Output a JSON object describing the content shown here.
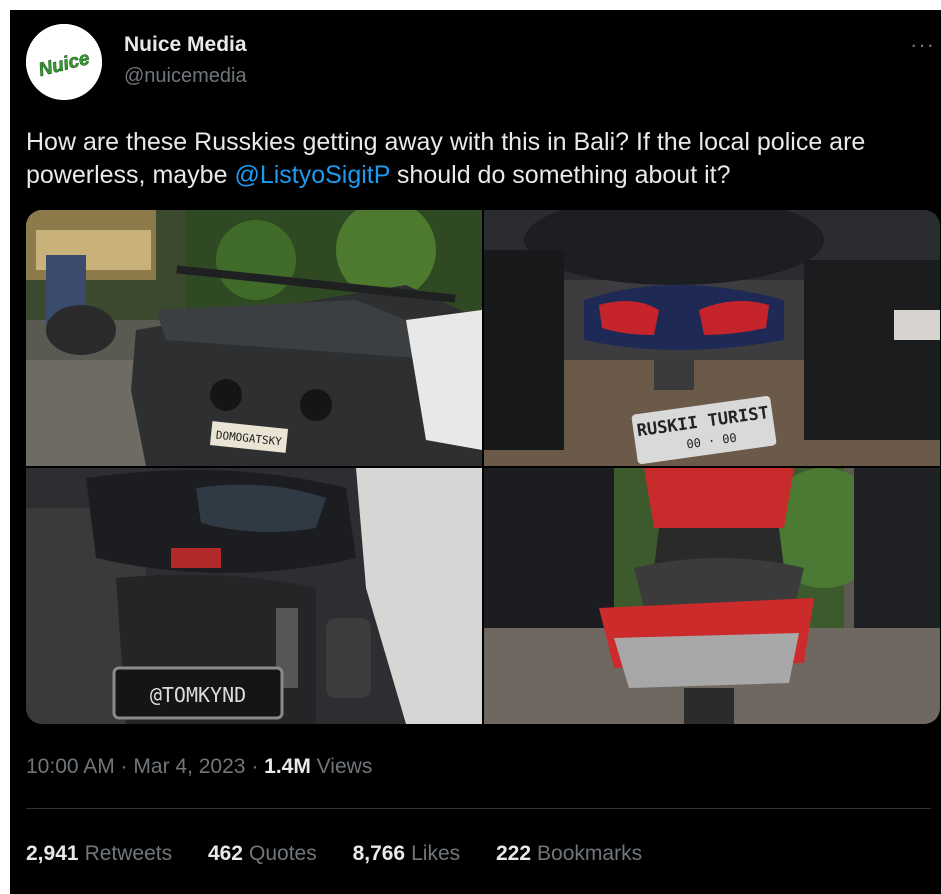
{
  "account": {
    "display_name": "Nuice Media",
    "handle": "@nuicemedia",
    "avatar_text": "Nuice"
  },
  "more_label": "···",
  "tweet": {
    "text_before": "How are these Russkies getting away with this in Bali? If the local police are powerless, maybe ",
    "mention": "@ListyoSigitP",
    "text_after": " should do something about it?"
  },
  "photos": [
    {
      "description_icon": "sports-car-photo",
      "plate": "DOMOGATSKY"
    },
    {
      "description_icon": "scooter-photo",
      "plate_line1": "RUSKII TURIST",
      "plate_line2": "00 · 00"
    },
    {
      "description_icon": "scooter-photo",
      "plate": "@TOMKYND"
    },
    {
      "description_icon": "red-scooter-photo"
    }
  ],
  "meta": {
    "time": "10:00 AM",
    "sep1": " · ",
    "date": "Mar 4, 2023",
    "sep2": " · ",
    "views_count": "1.4M",
    "views_label": " Views"
  },
  "stats": {
    "retweets_count": "2,941",
    "retweets_label": "Retweets",
    "quotes_count": "462",
    "quotes_label": "Quotes",
    "likes_count": "8,766",
    "likes_label": "Likes",
    "bookmarks_count": "222",
    "bookmarks_label": "Bookmarks"
  },
  "colors": {
    "background": "#000000",
    "text": "#e7e9ea",
    "secondary": "#71767b",
    "link": "#1d9bf0",
    "divider": "#2f3336",
    "avatar_green": "#3a9b2f"
  }
}
